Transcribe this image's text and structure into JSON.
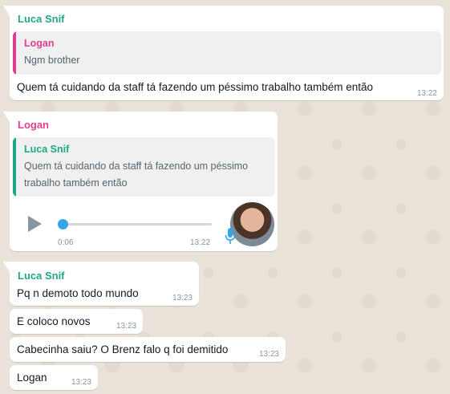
{
  "chat": {
    "messages": [
      {
        "sender": "Luca Snif",
        "quote": {
          "author": "Logan",
          "text": "Ngm brother"
        },
        "text": "Quem tá cuidando da staff tá fazendo um péssimo trabalho também então",
        "time": "13:22"
      },
      {
        "sender": "Logan",
        "quote": {
          "author": "Luca Snif",
          "line1": "Quem tá cuidando da staff tá fazendo um péssimo",
          "line2": "trabalho também então"
        },
        "voice": {
          "elapsed": "0:06",
          "time": "13:22",
          "progress": 0
        },
        "icon": "microphone-icon"
      },
      {
        "sender": "Luca Snif",
        "text": "Pq n demoto todo mundo",
        "time": "13:23"
      },
      {
        "text": "E coloco novos",
        "time": "13:23"
      },
      {
        "text": "Cabecinha saiu? O Brenz falo q foi demitido",
        "time": "13:23"
      },
      {
        "text": "Logan",
        "time": "13:23"
      }
    ]
  },
  "colors": {
    "wallpaper": "#e9e2d9",
    "sender_teal": "#1fa885",
    "sender_pink": "#dd3f8e",
    "progress_blue": "#35a5e8",
    "mic_blue": "#35a5e8"
  }
}
